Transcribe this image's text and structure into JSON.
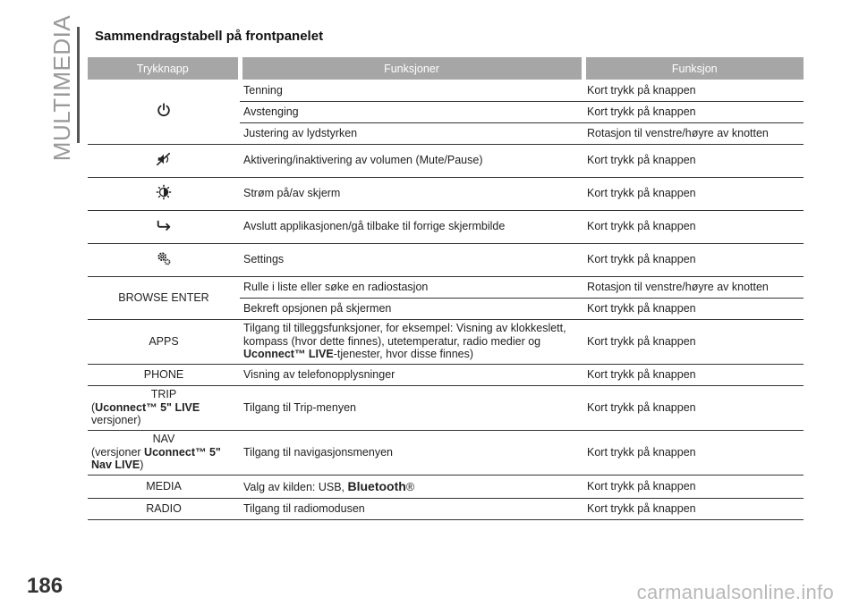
{
  "side_label": "MULTIMEDIA",
  "page_number": "186",
  "watermark": "carmanualsonline.info",
  "heading": "Sammendragstabell på frontpanelet",
  "table": {
    "headers": [
      "Trykknapp",
      "Funksjoner",
      "Funksjon"
    ],
    "power": {
      "icon": "power-icon",
      "rows": [
        {
          "function": "Tenning",
          "action": "Kort trykk på knappen"
        },
        {
          "function": "Avstenging",
          "action": "Kort trykk på knappen"
        },
        {
          "function": "Justering av lydstyrken",
          "action": "Rotasjon til venstre/høyre av knotten"
        }
      ]
    },
    "mute": {
      "icon": "mute-icon",
      "function": "Aktivering/inaktivering av volumen (Mute/Pause)",
      "action": "Kort trykk på knappen"
    },
    "screen": {
      "icon": "screen-brightness-icon",
      "function": "Strøm på/av skjerm",
      "action": "Kort trykk på knappen"
    },
    "back": {
      "icon": "back-arrow-icon",
      "function": "Avslutt applikasjonen/gå tilbake til forrige skjermbilde",
      "action": "Kort trykk på knappen"
    },
    "settings": {
      "icon": "gear-icon",
      "function": "Settings",
      "action": "Kort trykk på knappen"
    },
    "browse": {
      "button": "BROWSE ENTER",
      "rows": [
        {
          "function": "Rulle i liste eller søke en radiostasjon",
          "action": "Rotasjon til venstre/høyre av knotten"
        },
        {
          "function": "Bekreft opsjonen på skjermen",
          "action": "Kort trykk på knappen"
        }
      ]
    },
    "apps": {
      "button": "APPS",
      "function_line1": "Tilgang til tilleggsfunksjoner, for eksempel: Visning av klokkeslett,",
      "function_line2": "kompass (hvor dette finnes), utetemperatur, radio medier og",
      "function_bold": "Uconnect™ LIVE",
      "function_tail": "-tjenester, hvor disse finnes)",
      "action": "Kort trykk på knappen"
    },
    "phone": {
      "button": "PHONE",
      "function": "Visning av telefonopplysninger",
      "action": "Kort trykk på knappen"
    },
    "trip": {
      "button": "TRIP",
      "note_open": "(",
      "note_bold": "Uconnect™ 5\" LIVE",
      "note_tail": "versjoner)",
      "function": "Tilgang til Trip-menyen",
      "action": "Kort trykk på knappen"
    },
    "nav": {
      "button": "NAV",
      "note_pre": "(versjoner ",
      "note_bold1": "Uconnect™ 5\"",
      "note_bold2": "Nav LIVE",
      "note_close": ")",
      "function": "Tilgang til navigasjonsmenyen",
      "action": "Kort trykk på knappen"
    },
    "media": {
      "button": "MEDIA",
      "function_pre": "Valg av kilden: USB, ",
      "function_bold": "Bluetooth",
      "function_mark": "®",
      "action": "Kort trykk på knappen"
    },
    "radio": {
      "button": "RADIO",
      "function": "Tilgang til radiomodusen",
      "action": "Kort trykk på knappen"
    }
  }
}
